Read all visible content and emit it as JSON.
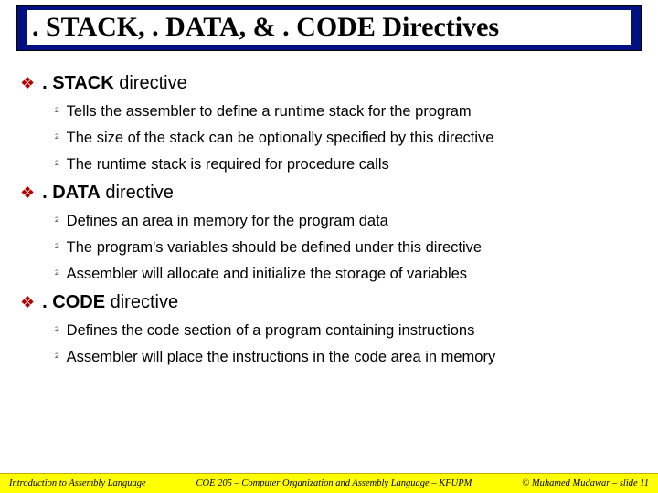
{
  "title": ". STACK, . DATA, & . CODE Directives",
  "sections": [
    {
      "head_strong": ". STACK",
      "head_rest": " directive",
      "items": [
        "Tells the assembler to define a runtime stack for the program",
        "The size of the stack can be optionally specified by this directive",
        "The runtime stack is required for procedure calls"
      ]
    },
    {
      "head_strong": ". DATA",
      "head_rest": " directive",
      "items": [
        "Defines an area in memory for the program data",
        "The program's variables should be defined under this directive",
        "Assembler will allocate and initialize the storage of variables"
      ]
    },
    {
      "head_strong": ". CODE",
      "head_rest": " directive",
      "items": [
        "Defines the code section of a program containing instructions",
        "Assembler will place the instructions in the code area in memory"
      ]
    }
  ],
  "footer": {
    "left": "Introduction to Assembly Language",
    "center": "COE 205 – Computer Organization and Assembly Language – KFUPM",
    "right": "© Muhamed Mudawar – slide 11"
  },
  "bullets": {
    "l1": "❖",
    "l2": "²"
  }
}
